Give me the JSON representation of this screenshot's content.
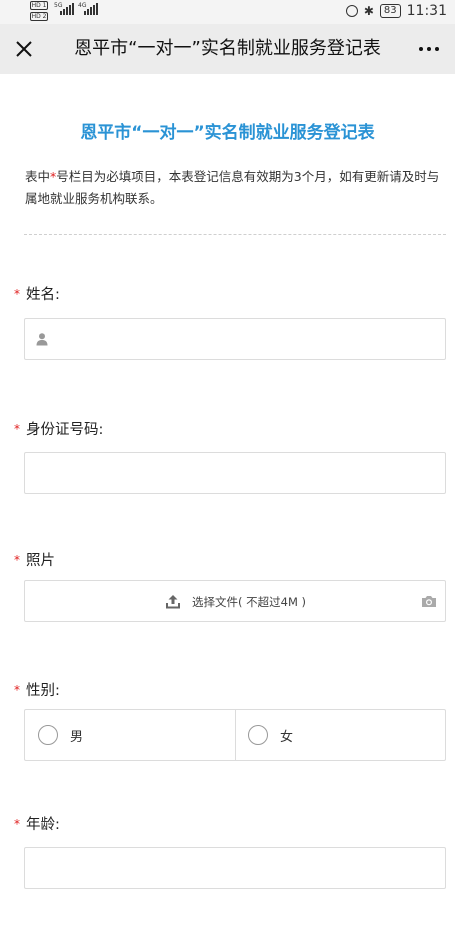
{
  "status_bar": {
    "sim1": "HD 1",
    "sim2": "HD 2",
    "network1": "5G",
    "network2": "4G",
    "battery": "83",
    "time": "11:31"
  },
  "nav": {
    "title": "恩平市“一对一”实名制就业服务登记表",
    "close_icon": "close-icon",
    "more_icon": "more-icon"
  },
  "form": {
    "title": "恩平市“一对一”实名制就业服务登记表",
    "intro_before": "表中",
    "intro_star": "*",
    "intro_after": "号栏目为必填项目，本表登记信息有效期为3个月，如有更新请及时与属地就业服务机构联系。",
    "required_mark": "*",
    "fields": {
      "name": {
        "label": "姓名:",
        "value": ""
      },
      "id_number": {
        "label": "身份证号码:",
        "value": ""
      },
      "photo": {
        "label": "照片",
        "upload_text": "选择文件( 不超过4M )"
      },
      "gender": {
        "label": "性别:",
        "options": [
          "男",
          "女"
        ],
        "selected": ""
      },
      "age": {
        "label": "年龄:",
        "value": ""
      }
    }
  }
}
